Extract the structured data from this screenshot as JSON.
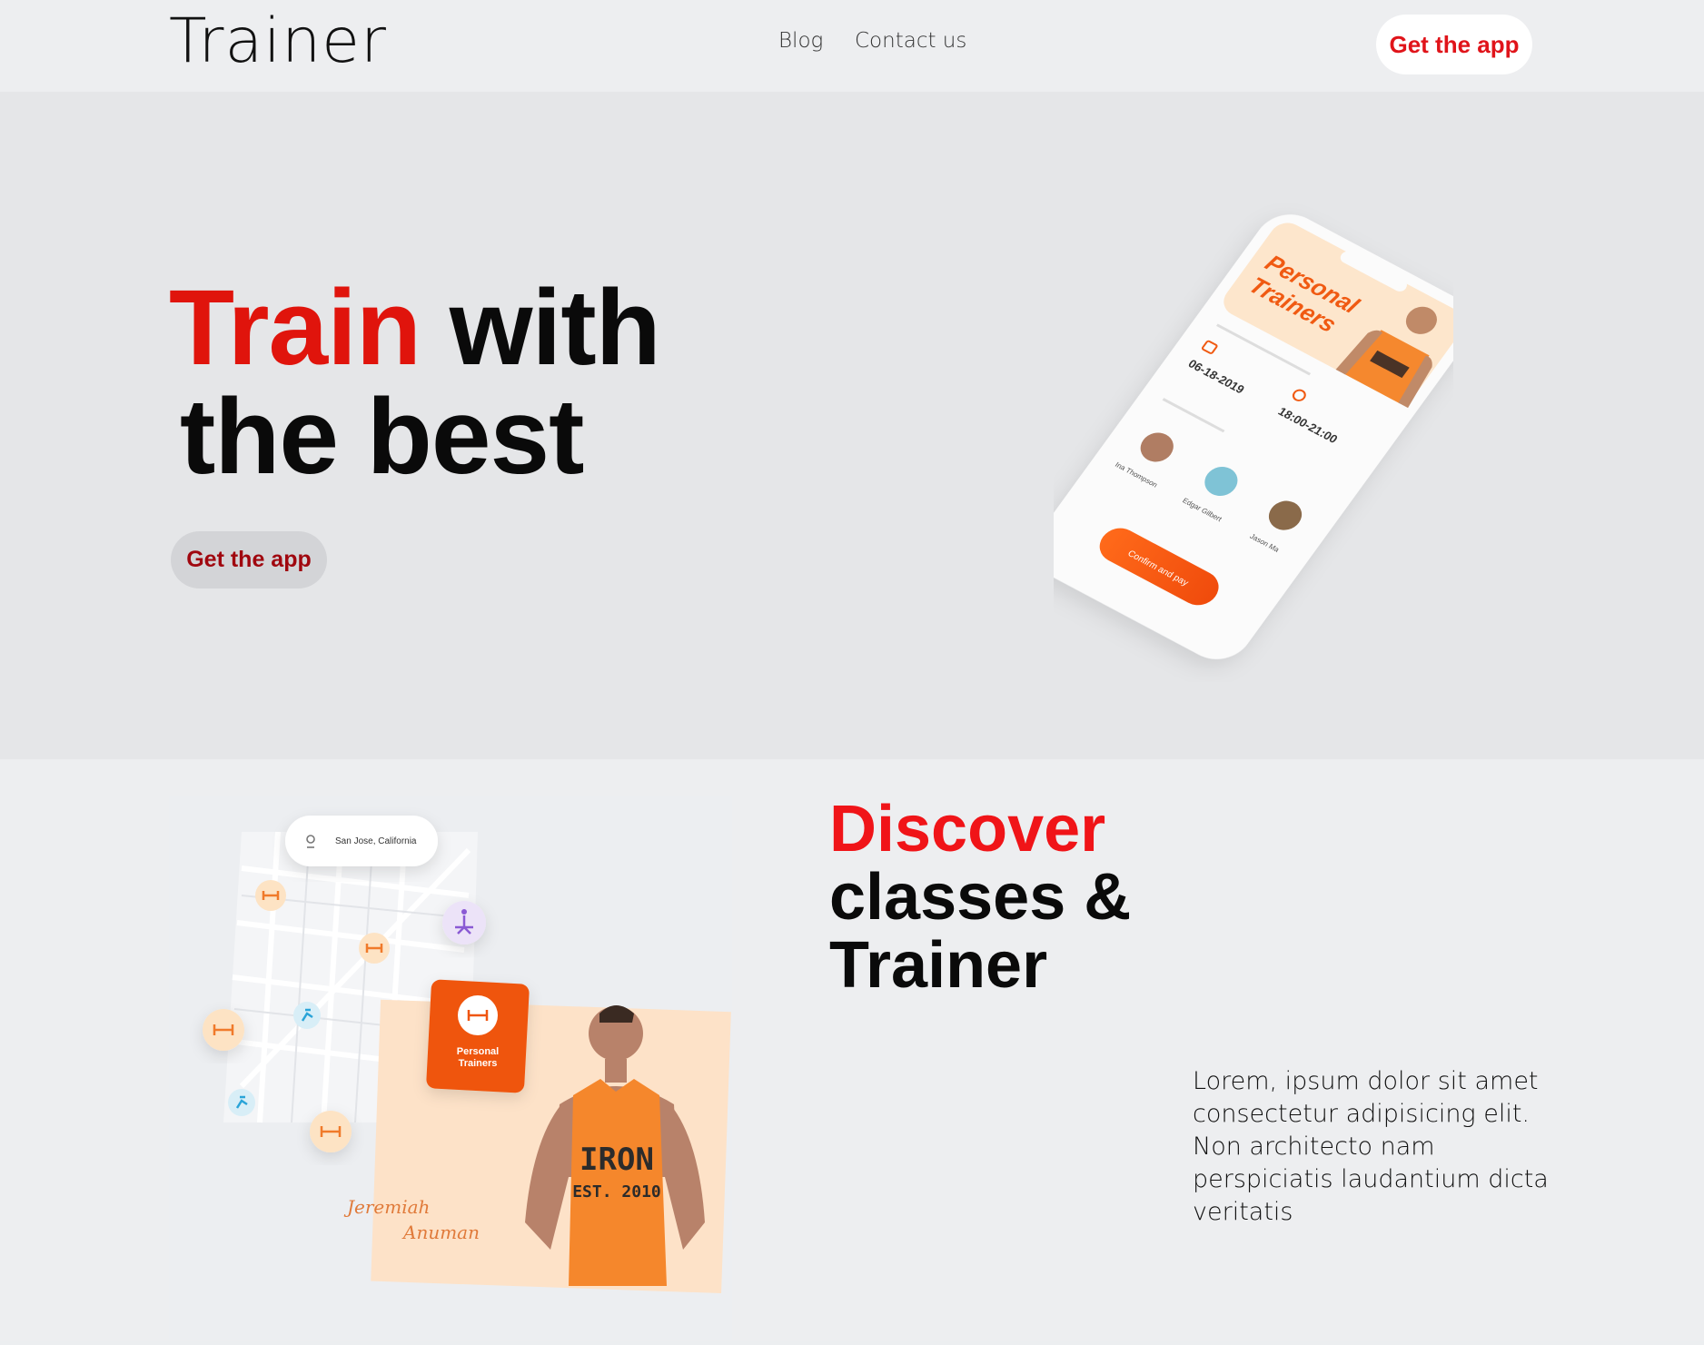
{
  "nav": {
    "logo": "Trainer",
    "links": [
      "Blog",
      "Contact us"
    ],
    "cta_label": "Get the app"
  },
  "hero": {
    "title_accent": "Train",
    "title_rest": " with",
    "title_line2": "the best",
    "cta_label": "Get the app",
    "phone": {
      "banner_line1": "Personal",
      "banner_line2": "Trainers",
      "date": "06-18-2019",
      "time": "18:00-21:00",
      "trainers": [
        "Ina Thompson",
        "Edgar Gilbert",
        "Jason Ma"
      ],
      "button_label": "Confirm and pay"
    }
  },
  "discover": {
    "title_accent": "Discover",
    "title_line2": "classes &",
    "title_line3": "Trainer",
    "body": "Lorem, ipsum dolor sit amet consectetur adipisicing elit. Non architecto nam perspiciatis laudantium dicta veritatis",
    "image": {
      "location": "San Jose, California",
      "card_label_1": "Personal",
      "card_label_2": "Trainers",
      "signature_1": "Jeremiah",
      "signature_2": "Anuman",
      "shirt_text_1": "IRON",
      "shirt_text_2": "EST. 2010"
    }
  },
  "colors": {
    "accent_red": "#e0140c",
    "orange": "#f15a13",
    "hero_bg": "#e5e6e8",
    "page_bg": "#edeef0"
  }
}
